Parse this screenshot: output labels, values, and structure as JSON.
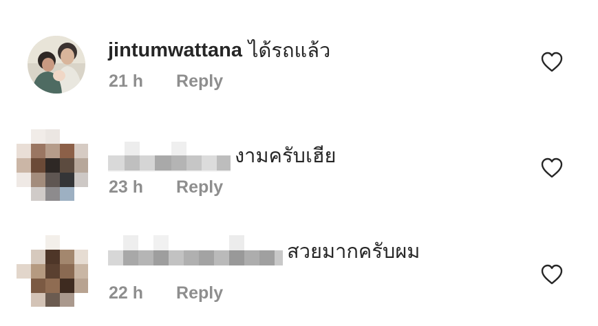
{
  "comments": [
    {
      "username": "jintumwattana",
      "text": "ได้รถแล้ว",
      "time": "21 h",
      "reply_label": "Reply",
      "avatar": "profile-photo",
      "like_icon": "heart-outline-icon"
    },
    {
      "username": "",
      "text": "งามครับเฮีย",
      "time": "23 h",
      "reply_label": "Reply",
      "avatar": "pixelated-avatar",
      "like_icon": "heart-outline-icon"
    },
    {
      "username": "",
      "text": "สวยมากครับผม",
      "time": "22 h",
      "reply_label": "Reply",
      "avatar": "pixelated-avatar",
      "like_icon": "heart-outline-icon"
    }
  ],
  "colors": {
    "text_primary": "#262626",
    "text_secondary": "#8e8e8e",
    "background": "#ffffff"
  }
}
